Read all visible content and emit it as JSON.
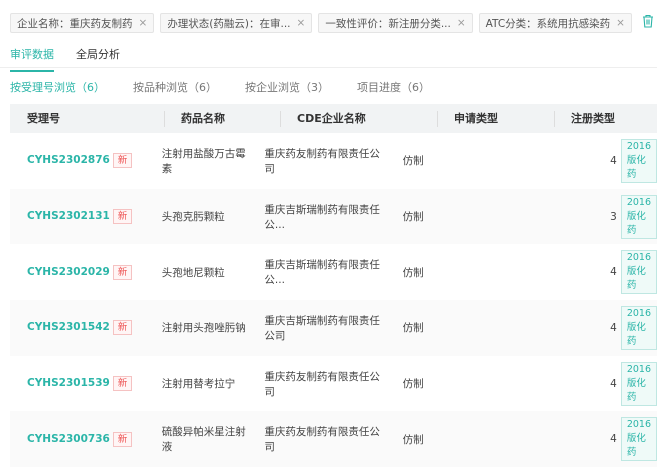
{
  "filters": [
    {
      "label": "企业名称：重庆药友制药"
    },
    {
      "label": "办理状态(药融云)：在审..."
    },
    {
      "label": "一致性评价：新注册分类..."
    },
    {
      "label": "ATC分类：系统用抗感染药"
    }
  ],
  "close_glyph": "×",
  "trash_icon": "trash-icon",
  "tabs": [
    "审评数据",
    "全局分析"
  ],
  "subtabs": [
    "按受理号浏览（6）",
    "按品种浏览（6）",
    "按企业浏览（3）",
    "项目进度（6）"
  ],
  "columns": [
    "受理号",
    "药品名称",
    "CDE企业名称",
    "申请类型",
    "注册类型"
  ],
  "new_badge": "新",
  "rows": [
    {
      "id": "CYHS2302876",
      "drug": "注射用盐酸万古霉素",
      "company": "重庆药友制药有限责任公司",
      "app_type": "仿制",
      "reg_num": "4",
      "reg_tag": "2016版化药"
    },
    {
      "id": "CYHS2302131",
      "drug": "头孢克肟颗粒",
      "company": "重庆吉斯瑞制药有限责任公...",
      "app_type": "仿制",
      "reg_num": "3",
      "reg_tag": "2016版化药"
    },
    {
      "id": "CYHS2302029",
      "drug": "头孢地尼颗粒",
      "company": "重庆吉斯瑞制药有限责任公...",
      "app_type": "仿制",
      "reg_num": "4",
      "reg_tag": "2016版化药"
    },
    {
      "id": "CYHS2301542",
      "drug": "注射用头孢唑肟钠",
      "company": "重庆吉斯瑞制药有限责任公司",
      "app_type": "仿制",
      "reg_num": "4",
      "reg_tag": "2016版化药"
    },
    {
      "id": "CYHS2301539",
      "drug": "注射用替考拉宁",
      "company": "重庆药友制药有限责任公司",
      "app_type": "仿制",
      "reg_num": "4",
      "reg_tag": "2016版化药"
    },
    {
      "id": "CYHS2300736",
      "drug": "硫酸异帕米星注射液",
      "company": "重庆药友制药有限责任公司",
      "app_type": "仿制",
      "reg_num": "4",
      "reg_tag": "2016版化药"
    }
  ],
  "colors": {
    "accent": "#2bb5a8",
    "new": "#e55555"
  }
}
